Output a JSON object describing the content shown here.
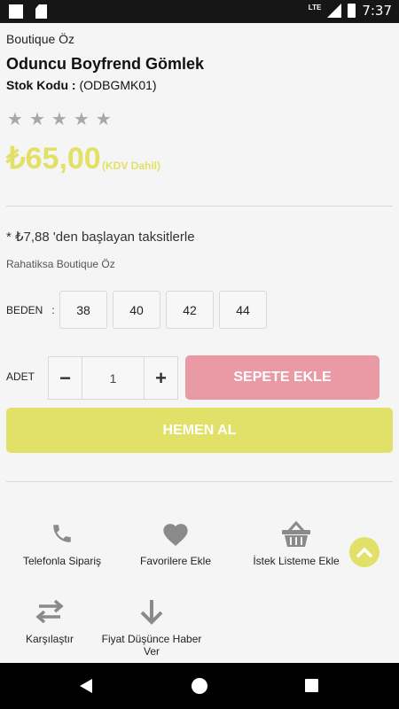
{
  "status_bar": {
    "network": "LTE",
    "time": "7:37"
  },
  "product": {
    "brand": "Boutique Öz",
    "name": "Oduncu Boyfrend Gömlek",
    "sku_label": "Stok Kodu :",
    "sku_value": "(ODBGMK01)",
    "rating": 0,
    "rating_max": 5,
    "price": "₺65,00",
    "vat_note": "(KDV Dahil)",
    "installment": "* ₺7,88 'den başlayan taksitlerle",
    "seller_note": "Rahatiksa Boutique Öz"
  },
  "size": {
    "label": "BEDEN",
    "separator": ":",
    "options": [
      "38",
      "40",
      "42",
      "44"
    ]
  },
  "quantity": {
    "label": "ADET",
    "minus": "−",
    "value": "1",
    "plus": "+"
  },
  "buttons": {
    "add_to_cart": "SEPETE EKLE",
    "buy_now": "HEMEN AL"
  },
  "actions": [
    {
      "icon": "phone-icon",
      "label": "Telefonla Sipariş"
    },
    {
      "icon": "heart-icon",
      "label": "Favorilere Ekle"
    },
    {
      "icon": "basket-icon",
      "label": "İstek Listeme Ekle"
    },
    {
      "icon": "compare-arrows-icon",
      "label": "Karşılaştır"
    },
    {
      "icon": "arrow-down-icon",
      "label": "Fiyat Düşünce Haber Ver"
    }
  ],
  "colors": {
    "accent_yellow": "#e1e169",
    "cart_pink": "#ea9aa5",
    "star_gray": "#a8a8a8",
    "icon_gray": "#8a8a8a"
  }
}
